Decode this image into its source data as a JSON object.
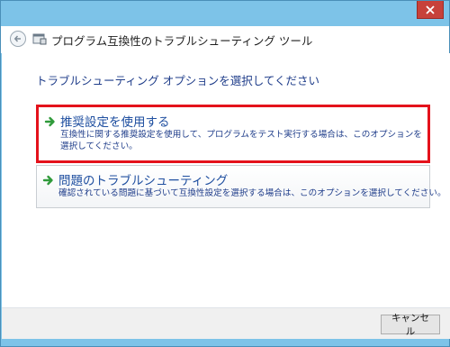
{
  "window": {
    "title": "プログラム互換性のトラブルシューティング ツール",
    "close_icon": "close-icon",
    "back_icon": "back-arrow-icon"
  },
  "main": {
    "heading": "トラブルシューティング オプションを選択してください",
    "options": [
      {
        "title": "推奨設定を使用する",
        "description": "互換性に関する推奨設定を使用して、プログラムをテスト実行する場合は、このオプションを選択してください。",
        "icon": "green-arrow-icon",
        "highlighted": true
      },
      {
        "title": "問題のトラブルシューティング",
        "description": "確認されている問題に基づいて互換性設定を選択する場合は、このオプションを選択してください。",
        "icon": "green-arrow-icon",
        "highlighted": false
      }
    ]
  },
  "footer": {
    "cancel_label": "キャンセル"
  },
  "colors": {
    "frame": "#7dc3e8",
    "highlight_border": "#e4121b",
    "link_text": "#1f4fa0",
    "close_button": "#c7413a"
  }
}
